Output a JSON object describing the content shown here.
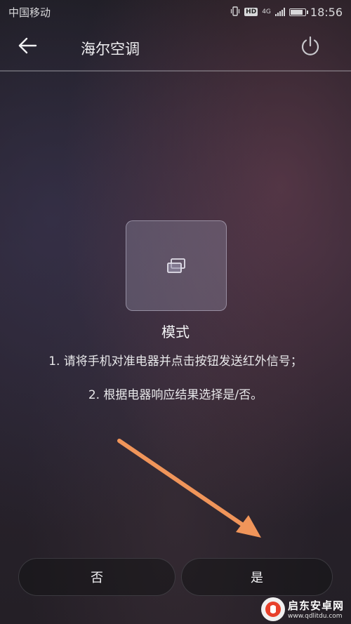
{
  "status_bar": {
    "carrier": "中国移动",
    "network": "4G",
    "hd": "HD",
    "time": "18:56"
  },
  "header": {
    "title": "海尔空调",
    "back_icon": "arrow-left-icon",
    "power_icon": "power-icon"
  },
  "mode": {
    "icon": "copy-windows-icon",
    "label": "模式"
  },
  "instructions": {
    "line1": "1. 请将手机对准电器并点击按钮发送红外信号；",
    "line2": "2. 根据电器响应结果选择是/否。"
  },
  "actions": {
    "no_label": "否",
    "yes_label": "是"
  },
  "watermark": {
    "title": "启东安卓网",
    "url": "www.qdlitdu.com"
  },
  "colors": {
    "annotation_arrow": "#f0955a",
    "accent_logo": "#e8402a"
  }
}
